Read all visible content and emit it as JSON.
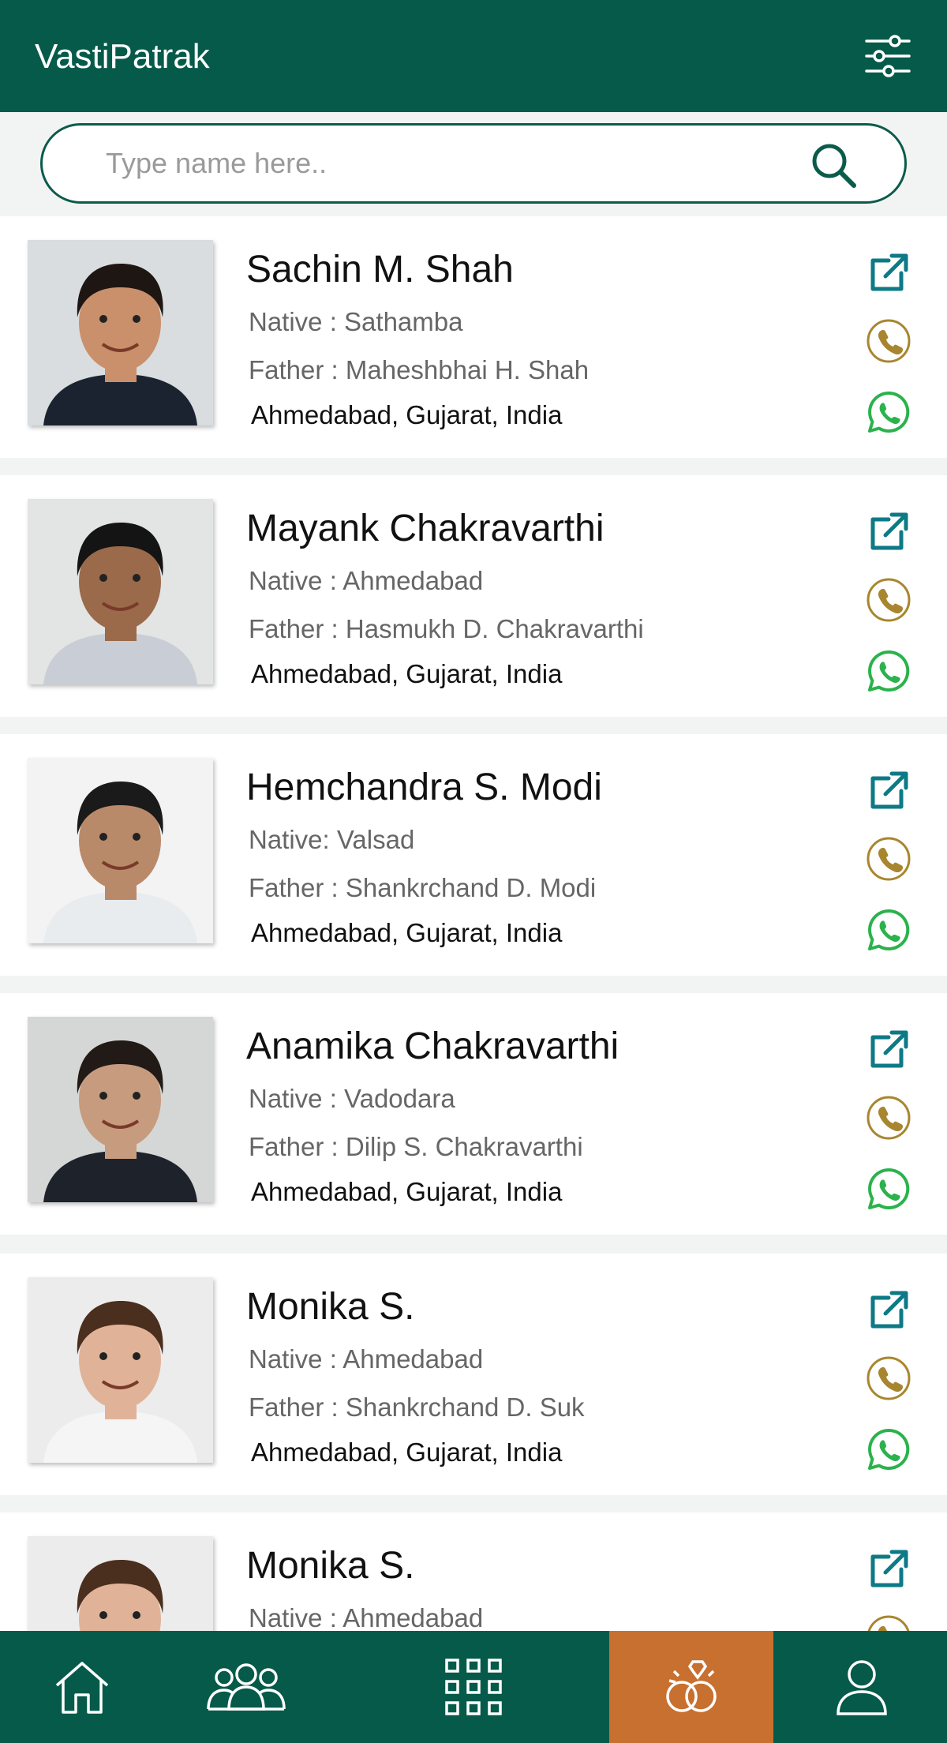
{
  "app": {
    "title": "VastiPatrak"
  },
  "search": {
    "placeholder": "Type name here.."
  },
  "icons": {
    "filter": "sliders-icon",
    "search": "search-icon",
    "open": "external-link-icon",
    "call": "phone-icon",
    "whatsapp": "whatsapp-icon"
  },
  "colors": {
    "brand": "#055a4a",
    "accent": "#c8702f",
    "link": "#0d7a86",
    "call": "#a8862f",
    "whatsapp": "#2bb24c"
  },
  "profiles": [
    {
      "name": "Sachin M. Shah",
      "native": "Native : Sathamba",
      "father": "Father : Maheshbhai H. Shah",
      "location": "Ahmedabad, Gujarat, India"
    },
    {
      "name": "Mayank Chakravarthi",
      "native": "Native : Ahmedabad",
      "father": "Father : Hasmukh D. Chakravarthi",
      "location": "Ahmedabad, Gujarat, India"
    },
    {
      "name": "Hemchandra S. Modi",
      "native": "Native: Valsad",
      "father": "Father : Shankrchand D. Modi",
      "location": "Ahmedabad, Gujarat, India"
    },
    {
      "name": "Anamika Chakravarthi",
      "native": "Native : Vadodara",
      "father": "Father : Dilip S. Chakravarthi",
      "location": "Ahmedabad, Gujarat, India"
    },
    {
      "name": "Monika S.",
      "native": "Native : Ahmedabad",
      "father": "Father : Shankrchand D. Suk",
      "location": "Ahmedabad, Gujarat, India"
    },
    {
      "name": "Monika S.",
      "native": "Native : Ahmedabad",
      "father": "",
      "location": ""
    }
  ],
  "nav": [
    {
      "icon": "home-icon",
      "active": false
    },
    {
      "icon": "group-icon",
      "active": false
    },
    {
      "icon": "grid-icon",
      "active": false
    },
    {
      "icon": "rings-icon",
      "active": true
    },
    {
      "icon": "user-icon",
      "active": false
    }
  ]
}
